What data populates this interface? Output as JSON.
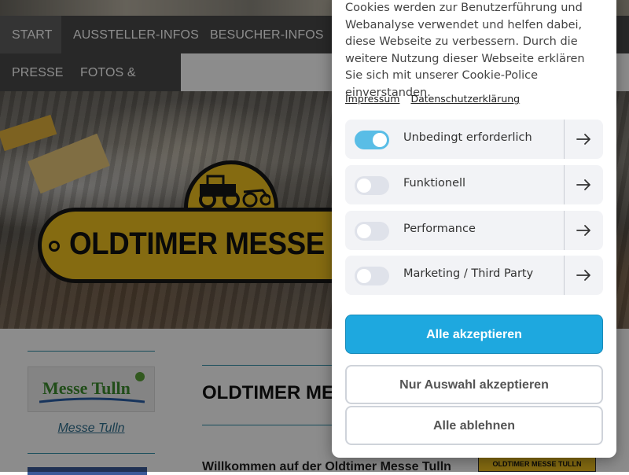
{
  "nav": {
    "row1": [
      {
        "label": "START",
        "active": true
      },
      {
        "label": "AUSSTELLER-INFOS",
        "active": false
      },
      {
        "label": "BESUCHER-INFOS",
        "active": false
      }
    ],
    "row2": [
      {
        "label": "PRESSE",
        "active": false
      },
      {
        "label": "FOTOS & VIDEO",
        "active": false
      }
    ]
  },
  "hero": {
    "logo_text": "OLDTIMER MESSE TULLN"
  },
  "sidebar": {
    "logo_text": "Messe Tulln",
    "link": "Messe Tulln"
  },
  "main": {
    "title": "OLDTIMER MESSE TULLN",
    "welcome": "Willkommen auf der Oldtimer Messe Tulln",
    "thumb_text": "OLDTIMER MESSE TULLN"
  },
  "cookie": {
    "text": "Cookies werden zur Benutzerführung und Webanalyse verwendet und helfen dabei, diese Webseite zu verbessern. Durch die weitere Nutzung dieser Webseite erklären Sie sich mit unserer Cookie-Police einverstanden.",
    "links": [
      "Impressum",
      "Datenschutzerklärung"
    ],
    "categories": [
      {
        "label": "Unbedingt erforderlich",
        "enabled": true
      },
      {
        "label": "Funktionell",
        "enabled": false
      },
      {
        "label": "Performance",
        "enabled": false
      },
      {
        "label": "Marketing / Third Party",
        "enabled": false
      }
    ],
    "buttons": {
      "accept_all": "Alle akzeptieren",
      "accept_selection": "Nur Auswahl akzeptieren",
      "reject_all": "Alle ablehnen"
    }
  },
  "colors": {
    "nav_bg": "#4a4a4a",
    "accent_blue": "#1ea8df",
    "toggle_on": "#59bde6",
    "logo_yellow": "#f2c320",
    "divider_teal": "#2e8fa8"
  }
}
